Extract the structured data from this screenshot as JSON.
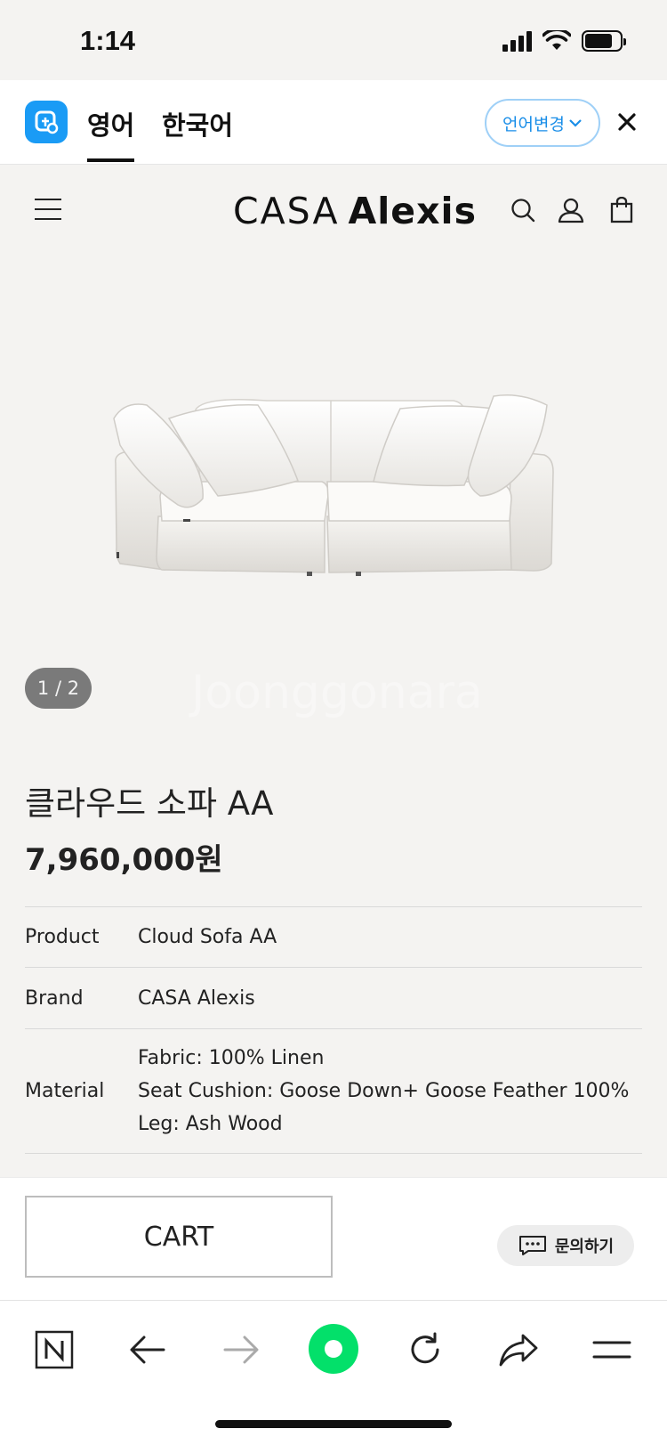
{
  "status_bar": {
    "time": "1:14"
  },
  "translate_bar": {
    "tabs": [
      {
        "label": "영어",
        "active": true
      },
      {
        "label": "한국어",
        "active": false
      }
    ],
    "change_language_label": "언어변경",
    "accent_color": "#1a9bf5"
  },
  "site_header": {
    "brand_part1": "CASA",
    "brand_part2": "Alexis",
    "icons": [
      "menu-icon",
      "search-icon",
      "user-icon",
      "bag-icon"
    ]
  },
  "gallery": {
    "current": 1,
    "total": 2,
    "counter_text": "1 / 2"
  },
  "product": {
    "title": "클라우드 소파 AA",
    "price": "7,960,000원",
    "specs": [
      {
        "label": "Product",
        "values": [
          "Cloud Sofa AA"
        ]
      },
      {
        "label": "Brand",
        "values": [
          "CASA Alexis"
        ]
      },
      {
        "label": "Material",
        "values": [
          "Fabric: 100% Linen",
          "Seat Cushion: Goose Down+ Goose Feather 100%",
          "Leg: Ash Wood"
        ]
      }
    ]
  },
  "actions": {
    "cart_label": "CART",
    "inquiry_label": "문의하기"
  },
  "browser_toolbar": {
    "buttons": [
      "naver-n-icon",
      "back-arrow-icon",
      "forward-arrow-icon",
      "green-dot-icon",
      "reload-icon",
      "share-icon",
      "menu-lines-icon"
    ],
    "green_color": "#03e06a"
  }
}
